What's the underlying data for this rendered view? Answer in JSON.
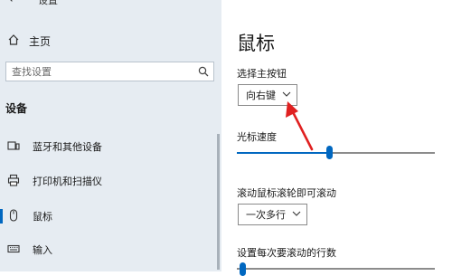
{
  "window": {
    "title": "设置"
  },
  "sidebar": {
    "home_label": "主页",
    "search_placeholder": "查找设置",
    "section_title": "设备",
    "items": [
      {
        "label": "蓝牙和其他设备",
        "icon": "bluetooth-devices-icon"
      },
      {
        "label": "打印机和扫描仪",
        "icon": "printer-icon"
      },
      {
        "label": "鼠标",
        "icon": "mouse-icon",
        "active": true
      },
      {
        "label": "输入",
        "icon": "keyboard-icon"
      }
    ]
  },
  "main": {
    "title": "鼠标",
    "primary_button": {
      "label": "选择主按钮",
      "value": "向右键"
    },
    "cursor_speed": {
      "label": "光标速度",
      "value_fraction": 0.47
    },
    "scroll_wheel": {
      "label": "滚动鼠标滚轮即可滚动",
      "value": "一次多行"
    },
    "lines_per_scroll": {
      "label": "设置每次要滚动的行数"
    }
  },
  "colors": {
    "accent": "#0067c0",
    "sidebar_bg": "#e6ecf2",
    "annotation_arrow": "#e02020"
  }
}
